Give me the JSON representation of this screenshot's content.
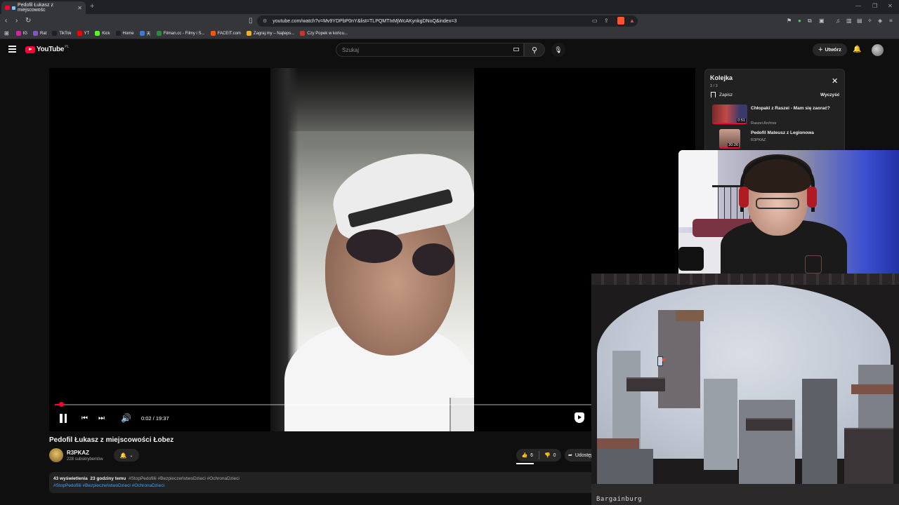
{
  "browser": {
    "tab_title": "Pedofil Łukasz z miejscowośc",
    "new_tab": "+",
    "url": "youtube.com/watch?v=Mv9YDPbP0nY&list=TLPQMTIxMjWcAKynkgDNoQ&index=3",
    "bookmarks": [
      {
        "label": "IG",
        "color": "#d6249f"
      },
      {
        "label": "Rat",
        "color": "#7e57c2"
      },
      {
        "label": "TikTok",
        "color": "#202020"
      },
      {
        "label": "YT",
        "color": "#ff0000"
      },
      {
        "label": "Kick",
        "color": "#53fc18"
      },
      {
        "label": "Home",
        "color": "#202020"
      },
      {
        "label": "天",
        "color": "#3a7bd5"
      },
      {
        "label": "Filman.cc - Filmy i S...",
        "color": "#2b8a3e"
      },
      {
        "label": "FACEIT.com",
        "color": "#ff5500"
      },
      {
        "label": "Zagraj.my – Najleps...",
        "color": "#f2b01e"
      },
      {
        "label": "Czy Popek w końcu...",
        "color": "#d32f2f"
      }
    ]
  },
  "header": {
    "logo": "YouTube",
    "country": "PL",
    "search_placeholder": "Szukaj",
    "create_label": "Utwórz"
  },
  "player": {
    "time": "0:02 / 19:37",
    "progress": 0.0017
  },
  "video": {
    "title": "Pedofil Łukasz z miejscowości Łobez",
    "channel": "R3PKAZ",
    "subscribers": "228 subskrybentów",
    "likes": "6",
    "dislikes": "0",
    "share": "Udostępnij",
    "views": "43 wyświetlenia",
    "age": "23 godziny temu",
    "tags_line1": "#StopPedofilii #BezpieczeństwoDzieci #OchronaDzieci",
    "tags_line2": "#StopPedofilii #BezpieczeństwoDzieci #OchronaDzieci"
  },
  "queue": {
    "title": "Kolejka",
    "count": "3 / 3",
    "save": "Zapisz",
    "clear": "Wyczyść",
    "items": [
      {
        "title": "Chłopaki z Raszei - Mam się zaorać?",
        "channel": "Raszei Archive",
        "duration": "0:51",
        "played": 1.0
      },
      {
        "title": "Pedofil Mateusz z Legionowa",
        "channel": "R3PKAZ",
        "duration": "20:26",
        "played": 1.0
      }
    ]
  },
  "game": {
    "label": "Bargainburg"
  }
}
